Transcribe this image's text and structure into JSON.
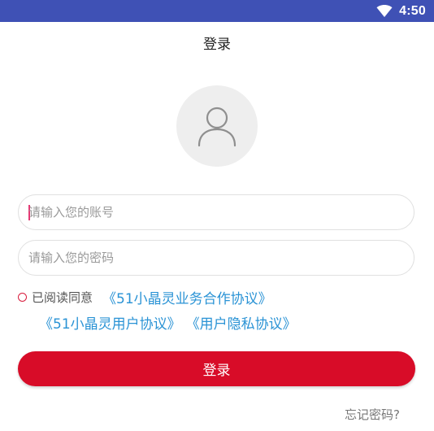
{
  "status_bar": {
    "time": "4:50",
    "wifi_icon": "wifi-icon",
    "background": "#3f51b5"
  },
  "page": {
    "title": "登录"
  },
  "avatar": {
    "icon": "user-icon"
  },
  "form": {
    "account_placeholder": "请输入您的账号",
    "account_value": "",
    "password_placeholder": "请输入您的密码",
    "password_value": ""
  },
  "agreement": {
    "checked": false,
    "prefix": "已阅读同意",
    "links": [
      "《51小晶灵业务合作协议》",
      "《51小晶灵用户协议》",
      "《用户隐私协议》"
    ],
    "link_color": "#2a93d5"
  },
  "login_button": {
    "label": "登录",
    "color": "#d80c28"
  },
  "forgot_password": {
    "label": "忘记密码?"
  }
}
